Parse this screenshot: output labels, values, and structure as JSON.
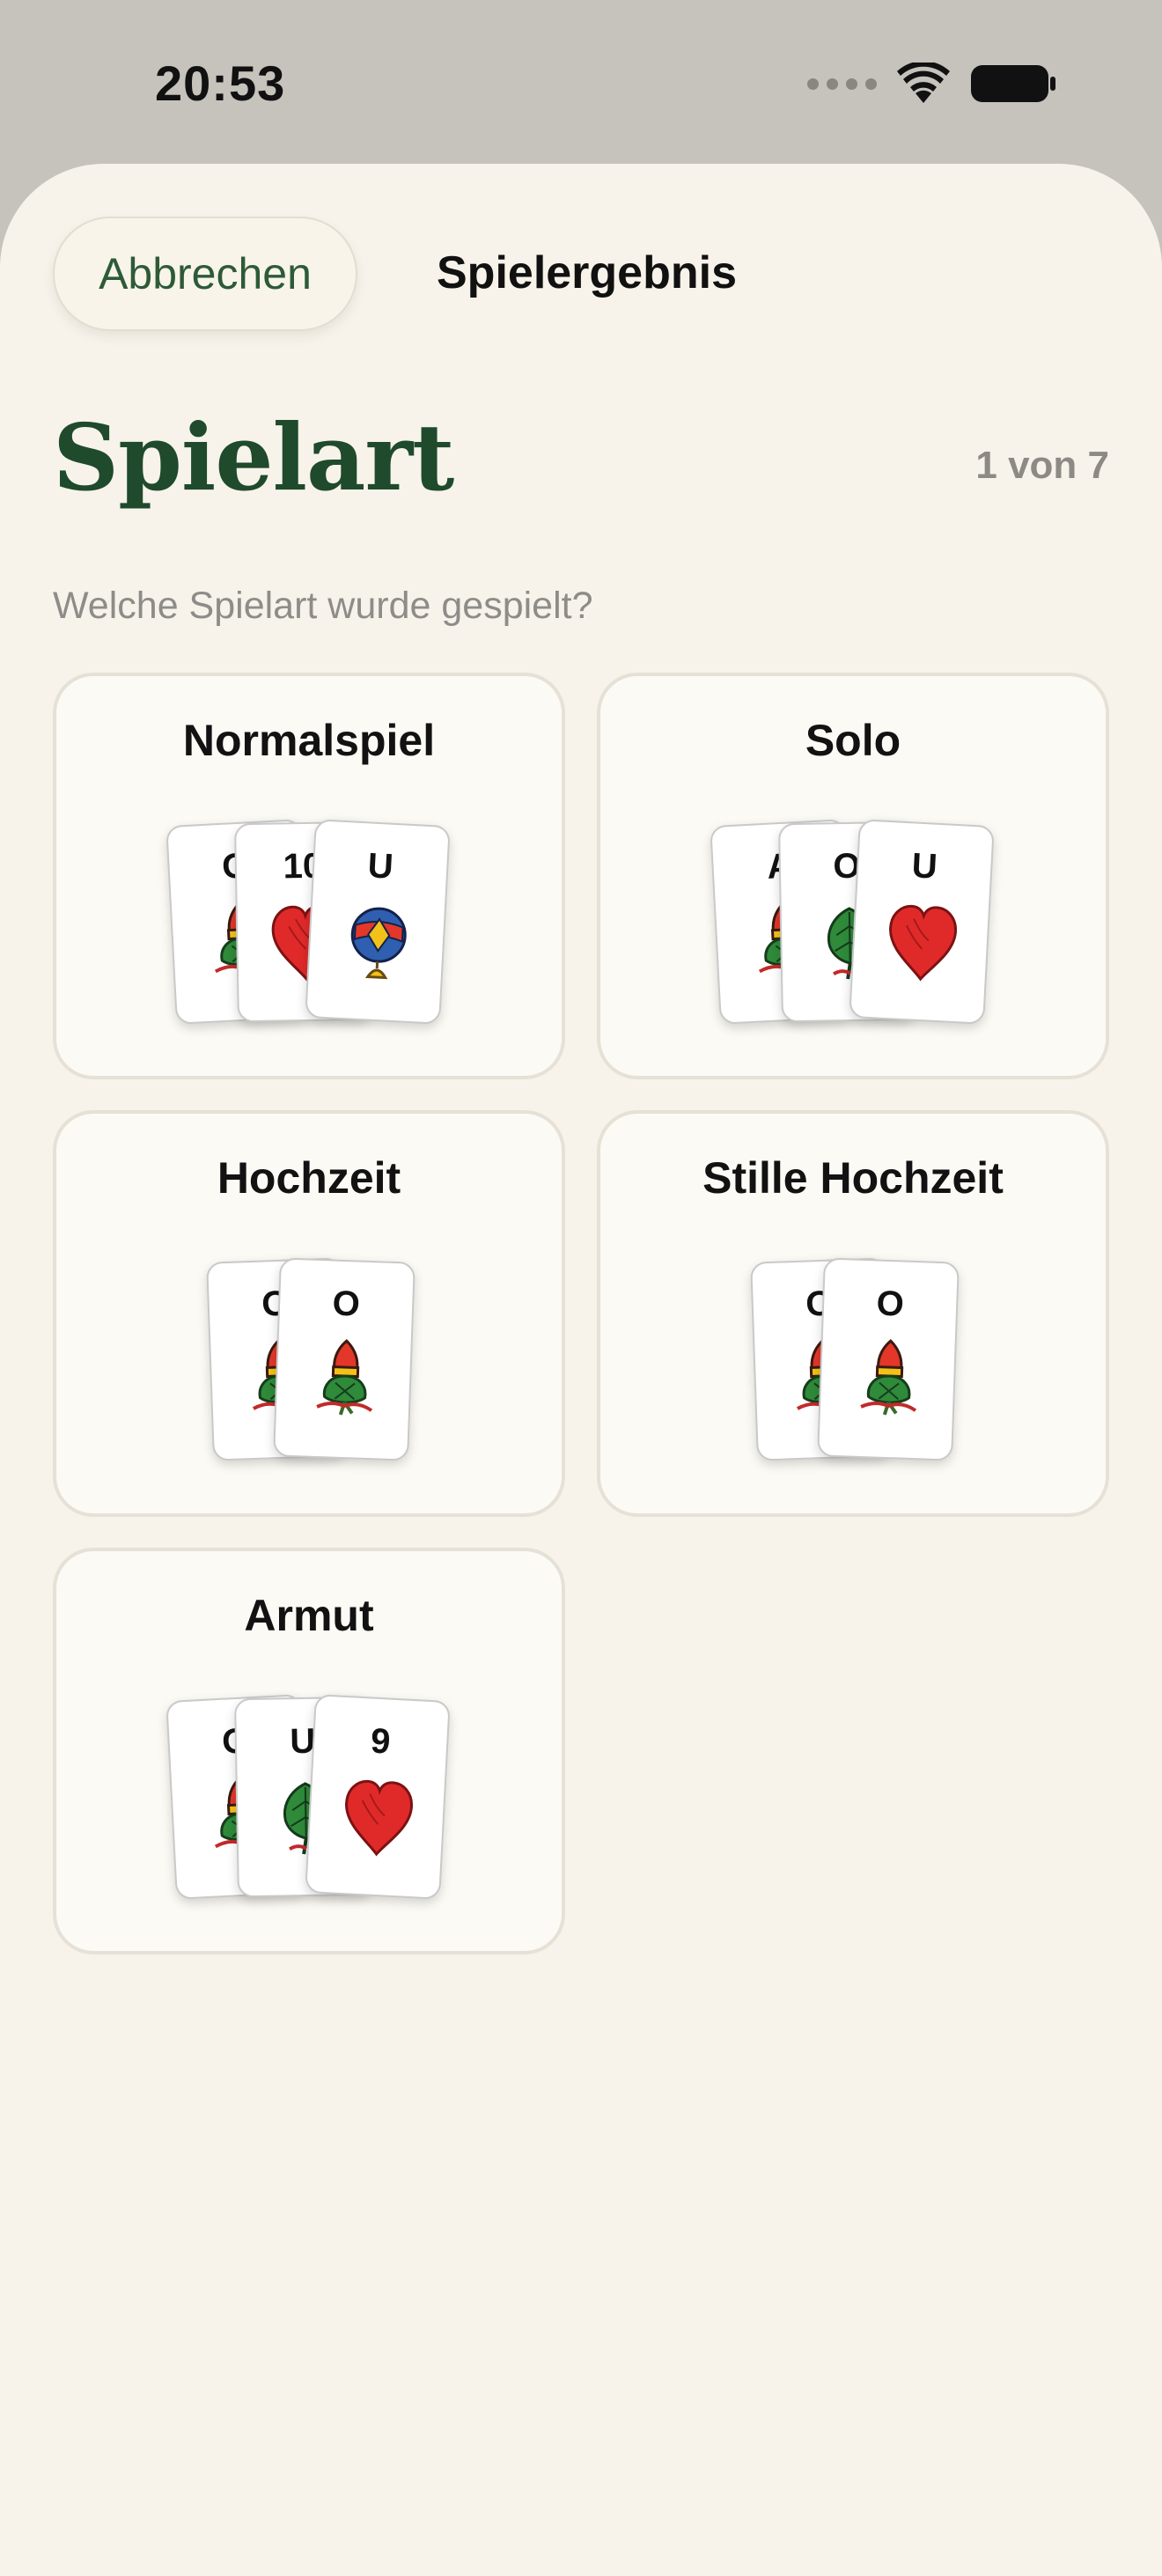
{
  "status_bar": {
    "time": "20:53"
  },
  "header": {
    "cancel_label": "Abbrechen",
    "nav_title": "Spielergebnis"
  },
  "page": {
    "title": "Spielart",
    "step": "1 von 7",
    "question": "Welche Spielart wurde gespielt?"
  },
  "colors": {
    "sheet_background": "#f7f3ea",
    "title_green": "#1f4a2c",
    "cancel_text": "#2e5a37",
    "card_border": "#e6e1d6"
  },
  "options": [
    {
      "title": "Normalspiel",
      "cards": [
        {
          "rank": "O",
          "suit": "eichel-icon"
        },
        {
          "rank": "10",
          "suit": "herz-icon"
        },
        {
          "rank": "U",
          "suit": "schellen-icon"
        }
      ]
    },
    {
      "title": "Solo",
      "cards": [
        {
          "rank": "A",
          "suit": "eichel-icon"
        },
        {
          "rank": "O",
          "suit": "gras-icon"
        },
        {
          "rank": "U",
          "suit": "herz-icon"
        }
      ]
    },
    {
      "title": "Hochzeit",
      "cards": [
        {
          "rank": "O",
          "suit": "eichel-icon"
        },
        {
          "rank": "O",
          "suit": "eichel-icon"
        }
      ]
    },
    {
      "title": "Stille Hochzeit",
      "cards": [
        {
          "rank": "O",
          "suit": "eichel-icon"
        },
        {
          "rank": "O",
          "suit": "eichel-icon"
        }
      ]
    },
    {
      "title": "Armut",
      "cards": [
        {
          "rank": "O",
          "suit": "eichel-icon"
        },
        {
          "rank": "U",
          "suit": "gras-icon"
        },
        {
          "rank": "9",
          "suit": "herz-icon"
        }
      ]
    }
  ]
}
